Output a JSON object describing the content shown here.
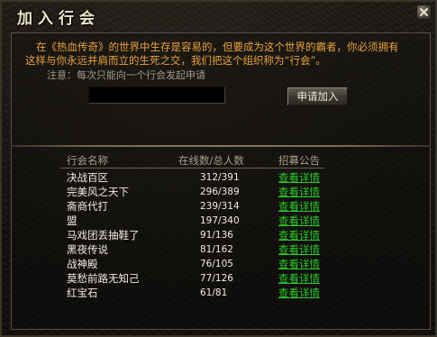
{
  "window": {
    "title": "加入行会"
  },
  "intro": {
    "text": "在《热血传奇》的世界中生存是容易的，但要成为这个世界的霸者，你必须拥有这样与你永远并肩而立的生死之交，我们把这个组织称为“行会”。",
    "note": "注意：每次只能向一个行会发起申请"
  },
  "form": {
    "input_value": "",
    "apply_label": "申请加入"
  },
  "table": {
    "headers": {
      "name": "行会名称",
      "count": "在线数/总人数",
      "ad": "招募公告"
    },
    "rows": [
      {
        "name": "决战百区",
        "count": "312/391",
        "link": "查看详情"
      },
      {
        "name": "完美风之天下",
        "count": "296/389",
        "link": "查看详情"
      },
      {
        "name": "斋商代打",
        "count": "239/314",
        "link": "查看详情"
      },
      {
        "name": "盟",
        "count": "197/340",
        "link": "查看详情"
      },
      {
        "name": "马戏团丢抽鞋了",
        "count": "91/136",
        "link": "查看详情"
      },
      {
        "name": "黑夜传说",
        "count": "81/162",
        "link": "查看详情"
      },
      {
        "name": "战神殿",
        "count": "76/105",
        "link": "查看详情"
      },
      {
        "name": "莫愁前路无知己",
        "count": "77/126",
        "link": "查看详情"
      },
      {
        "name": "红宝石",
        "count": "61/81",
        "link": "查看详情"
      }
    ]
  },
  "colors": {
    "intro_text": "#e9a23b",
    "link_green": "#29cc29",
    "title_text": "#efe6c8"
  }
}
